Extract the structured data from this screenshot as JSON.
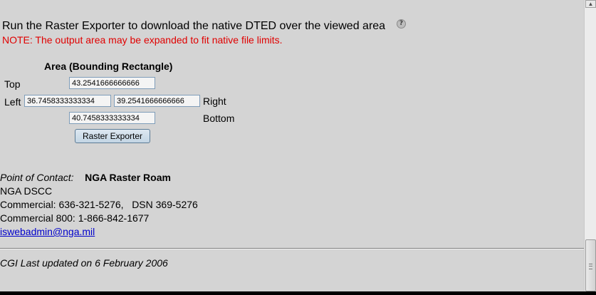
{
  "header": {
    "headline": "Run the Raster Exporter to download the native DTED over the viewed area",
    "help_icon_glyph": "?",
    "note": "NOTE: The output area may be expanded to fit native file limits."
  },
  "area": {
    "title": "Area (Bounding Rectangle)",
    "top_label": "Top",
    "top_value": "43.2541666666666",
    "left_label": "Left",
    "left_value": "36.7458333333334",
    "right_label": "Right",
    "right_value": "39.2541666666666",
    "bottom_label": "Bottom",
    "bottom_value": "40.7458333333334",
    "export_button_label": "Raster Exporter"
  },
  "contact": {
    "label": "Point of Contact:",
    "name": "NGA Raster Roam",
    "org": "NGA DSCC",
    "commercial": "Commercial: 636-321-5276,   DSN 369-5276",
    "commercial_800": "Commercial 800: 1-866-842-1677",
    "email": "iswebadmin@nga.mil"
  },
  "footer": {
    "updated": "CGI Last updated on 6 February 2006"
  },
  "scrollbar": {
    "up_arrow_glyph": "▲"
  },
  "colors": {
    "note": "#e00000",
    "link": "#0000cc",
    "background": "#d4d4d4"
  }
}
